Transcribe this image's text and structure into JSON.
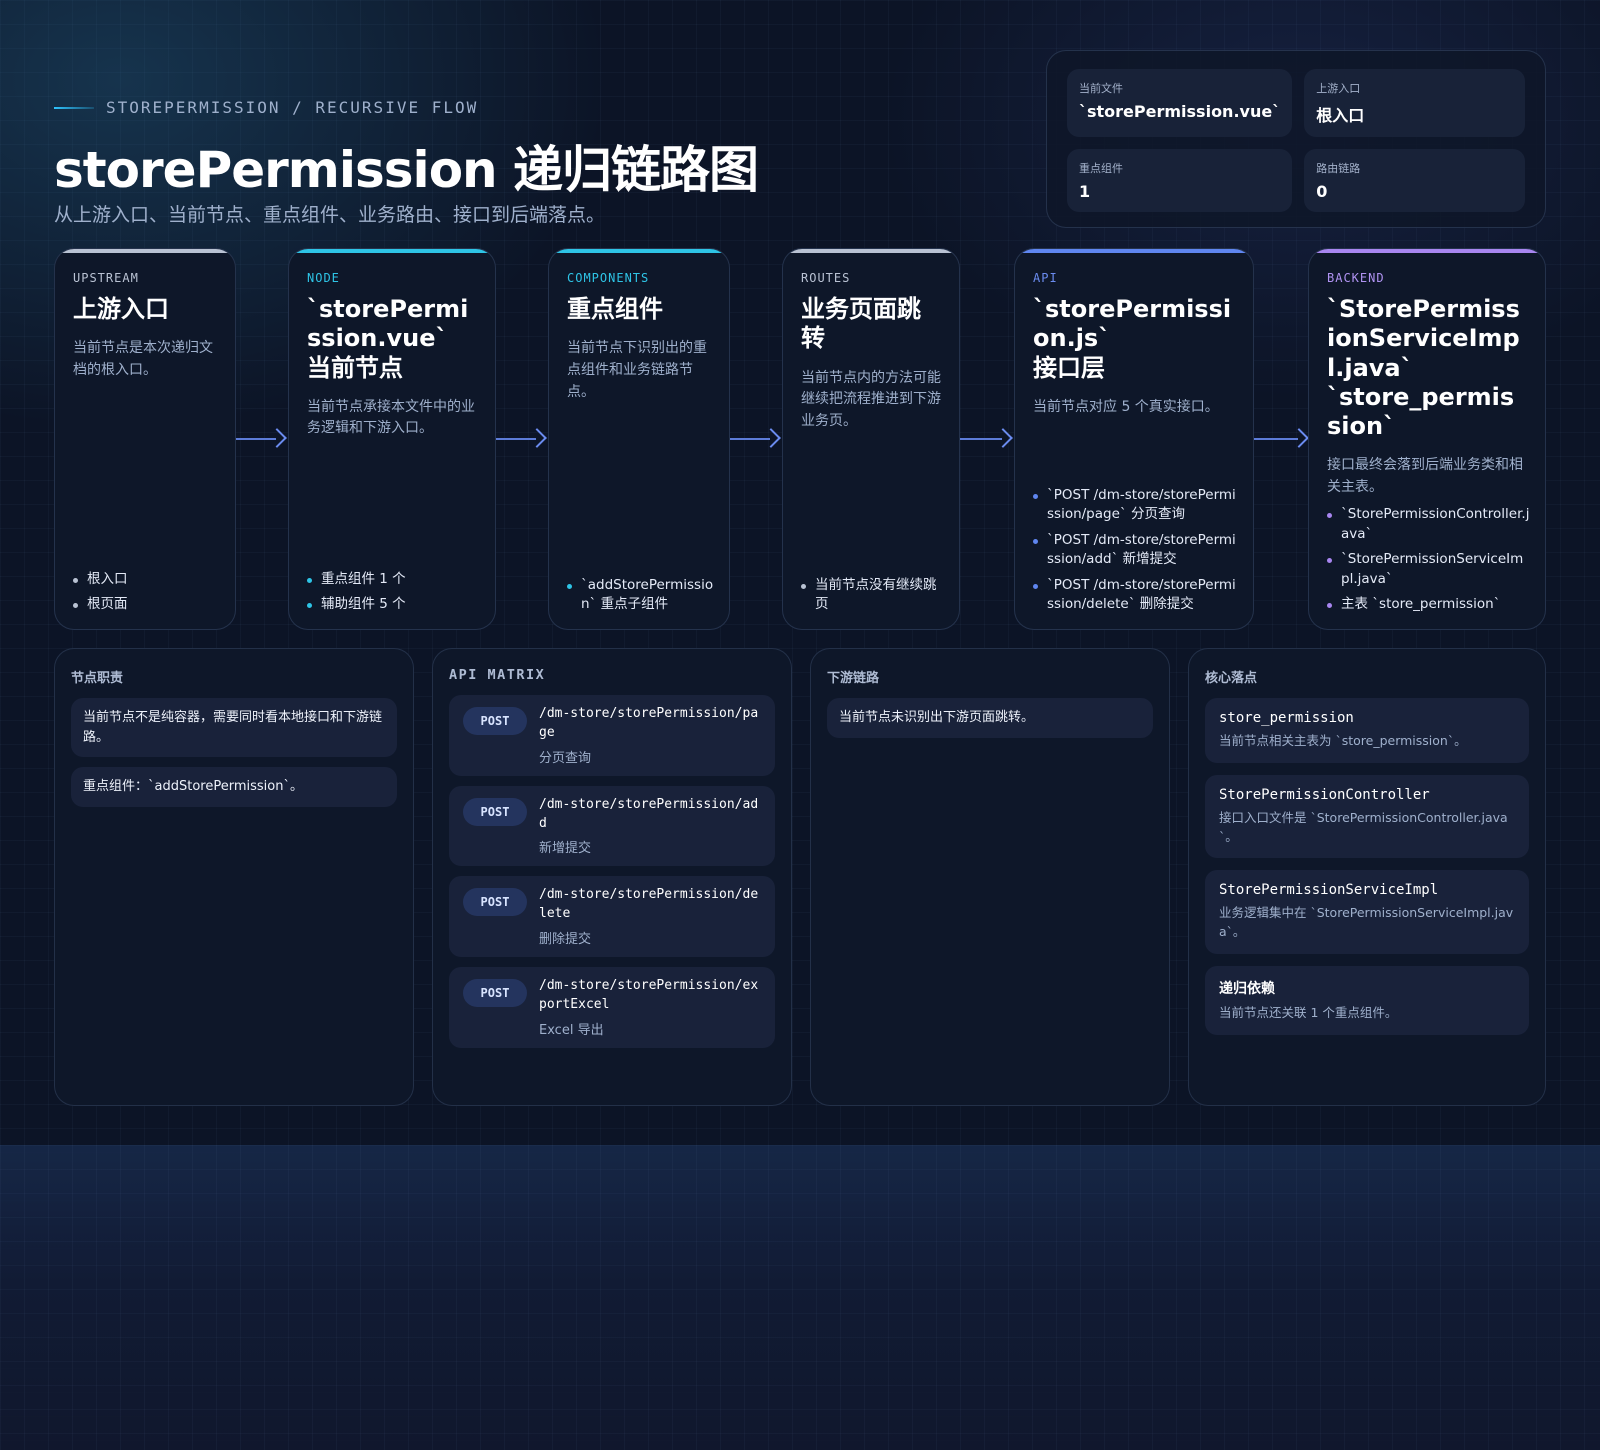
{
  "header": {
    "eyebrow": "STOREPERMISSION / RECURSIVE FLOW",
    "title": "storePermission 递归链路图",
    "subtitle": "从上游入口、当前节点、重点组件、业务路由、接口到后端落点。"
  },
  "stats": [
    {
      "label": "当前文件",
      "value": "`storePermission.vue`"
    },
    {
      "label": "上游入口",
      "value": "根入口"
    },
    {
      "label": "重点组件",
      "value": "1"
    },
    {
      "label": "路由链路",
      "value": "0"
    }
  ],
  "cards": [
    {
      "tag": "UPSTREAM",
      "title": "上游入口",
      "desc": "当前节点是本次递归文档的根入口。",
      "items": [
        "根入口",
        "根页面"
      ]
    },
    {
      "tag": "NODE",
      "title": "`storePermission.vue`\n当前节点",
      "desc": "当前节点承接本文件中的业务逻辑和下游入口。",
      "items": [
        "重点组件 1 个",
        "辅助组件 5 个"
      ]
    },
    {
      "tag": "COMPONENTS",
      "title": "重点组件",
      "desc": "当前节点下识别出的重点组件和业务链路节点。",
      "items": [
        "`addStorePermission` 重点子组件"
      ]
    },
    {
      "tag": "ROUTES",
      "title": "业务页面跳转",
      "desc": "当前节点内的方法可能继续把流程推进到下游业务页。",
      "items": [
        "当前节点没有继续跳页"
      ]
    },
    {
      "tag": "API",
      "title": "`storePermission.js`\n接口层",
      "desc": "当前节点对应 5 个真实接口。",
      "items": [
        "`POST /dm-store/storePermission/page` 分页查询",
        "`POST /dm-store/storePermission/add` 新增提交",
        "`POST /dm-store/storePermission/delete` 删除提交"
      ]
    },
    {
      "tag": "BACKEND",
      "title": "`StorePermissionServiceImpl.java`\n`store_permission`",
      "desc": "接口最终会落到后端业务类和相关主表。",
      "items": [
        "`StorePermissionController.java`",
        "`StorePermissionServiceImpl.java`",
        "主表 `store_permission`"
      ]
    }
  ],
  "panels": {
    "duty": {
      "title": "节点职责",
      "notes": [
        "当前节点不是纯容器，需要同时看本地接口和下游链路。",
        "重点组件：`addStorePermission`。"
      ]
    },
    "api": {
      "title": "API MATRIX",
      "items": [
        {
          "method": "POST",
          "path": "/dm-store/storePermission/page",
          "desc": "分页查询"
        },
        {
          "method": "POST",
          "path": "/dm-store/storePermission/add",
          "desc": "新增提交"
        },
        {
          "method": "POST",
          "path": "/dm-store/storePermission/delete",
          "desc": "删除提交"
        },
        {
          "method": "POST",
          "path": "/dm-store/storePermission/exportExcel",
          "desc": "Excel 导出"
        }
      ]
    },
    "downstream": {
      "title": "下游链路",
      "notes": [
        "当前节点未识别出下游页面跳转。"
      ]
    },
    "core": {
      "title": "核心落点",
      "items": [
        {
          "name": "store_permission",
          "desc": "当前节点相关主表为 `store_permission`。"
        },
        {
          "name": "StorePermissionController",
          "desc": "接口入口文件是 `StorePermissionController.java`。"
        },
        {
          "name": "StorePermissionServiceImpl",
          "desc": "业务逻辑集中在 `StorePermissionServiceImpl.java`。"
        },
        {
          "name": "递归依赖",
          "desc": "当前节点还关联 1 个重点组件。"
        }
      ]
    }
  },
  "colors": {
    "upstream": "#b9c2d3",
    "node": "#2ec4e6",
    "components": "#2ec4e6",
    "routes": "#b9c2d3",
    "api": "#5f86f0",
    "backend": "#a886f0"
  }
}
